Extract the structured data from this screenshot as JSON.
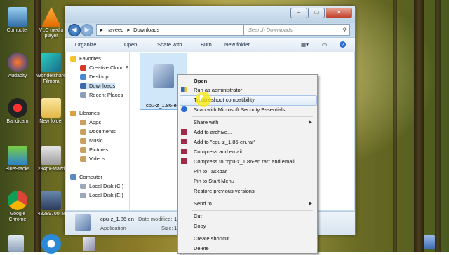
{
  "colors": {
    "selection": "#cce4f7",
    "menu_highlight": "#dfeaf8",
    "cursor_highlight": "#ffeb00"
  },
  "desktop": {
    "icons": [
      {
        "label": "Computer",
        "icon": "computer-icon"
      },
      {
        "label": "VLC media player",
        "icon": "vlc-icon"
      },
      {
        "label": "Audacity",
        "icon": "audacity-icon"
      },
      {
        "label": "Wondershare Filmora",
        "icon": "filmora-icon"
      },
      {
        "label": "Bandicam",
        "icon": "bandicam-icon"
      },
      {
        "label": "New folder",
        "icon": "folder-icon"
      },
      {
        "label": "BlueStacks",
        "icon": "bluestacks-icon"
      },
      {
        "label": "284px-Mazd",
        "icon": "image-icon"
      },
      {
        "label": "Google Chrome",
        "icon": "chrome-icon"
      },
      {
        "label": "43289700_8",
        "icon": "image-icon"
      },
      {
        "label": "",
        "icon": "internet-explorer-icon"
      }
    ]
  },
  "explorer": {
    "breadcrumb": [
      "naveed",
      "Downloads"
    ],
    "search_placeholder": "Search Downloads",
    "toolbar": {
      "organize": "Organize",
      "open": "Open",
      "share_with": "Share with",
      "burn": "Burn",
      "new_folder": "New folder"
    },
    "favorites_header": "Favorites",
    "favorites": [
      "Creative Cloud F",
      "Desktop",
      "Downloads",
      "Recent Places"
    ],
    "libraries_header": "Libraries",
    "libraries": [
      "Apps",
      "Documents",
      "Music",
      "Pictures",
      "Videos"
    ],
    "computer_header": "Computer",
    "drives": [
      "Local Disk (C:)",
      "Local Disk (E:)"
    ],
    "file": {
      "name": "cpu-z_1.86-en",
      "type": "Application"
    },
    "details": {
      "name": "cpu-z_1.86-en",
      "date_label": "Date modified:",
      "date_value": "10",
      "type": "Application",
      "size_label": "Size:",
      "size_value": "1."
    }
  },
  "context_menu": {
    "open": "Open",
    "run_as_admin": "Run as administrator",
    "troubleshoot": "Troubleshoot compatibility",
    "scan": "Scan with Microsoft Security Essentials...",
    "share_with": "Share with",
    "add_archive": "Add to archive...",
    "add_rar": "Add to \"cpu-z_1.86-en.rar\"",
    "compress_email": "Compress and email...",
    "compress_rar_email": "Compress to \"cpu-z_1.86-en.rar\" and email",
    "pin_taskbar": "Pin to Taskbar",
    "pin_start": "Pin to Start Menu",
    "restore": "Restore previous versions",
    "send_to": "Send to",
    "cut": "Cut",
    "copy": "Copy",
    "create_shortcut": "Create shortcut",
    "delete": "Delete"
  }
}
